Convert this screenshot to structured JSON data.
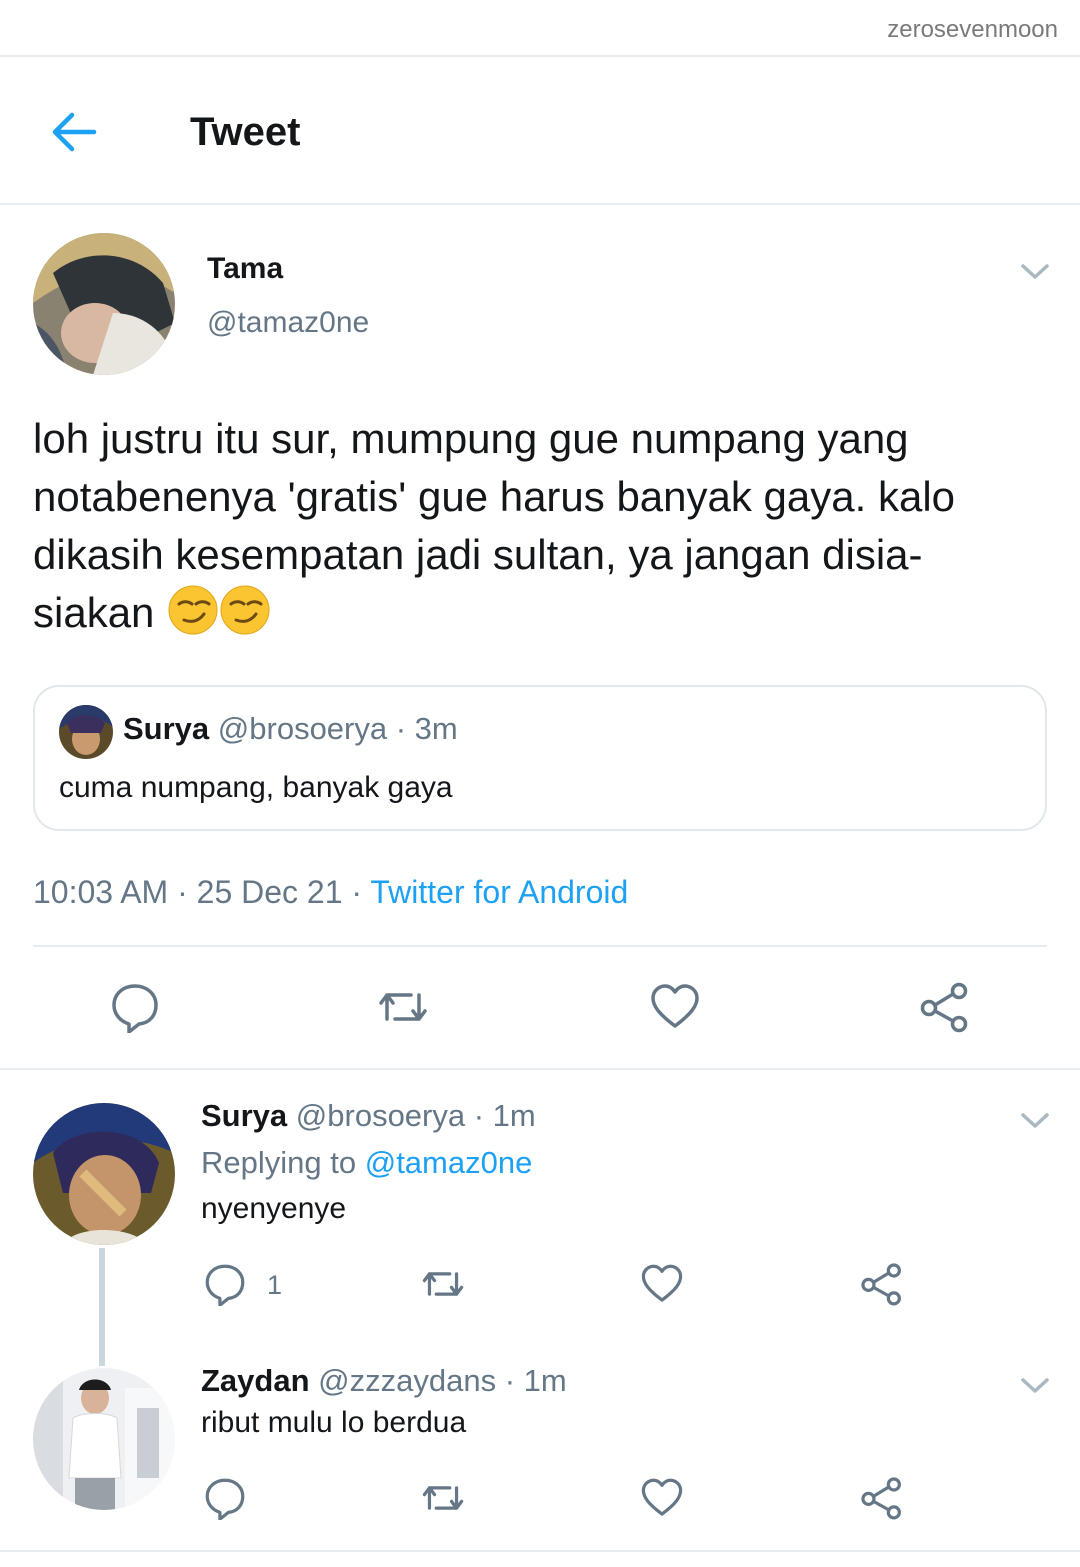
{
  "watermark": "zerosevenmoon",
  "header": {
    "title": "Tweet"
  },
  "main_tweet": {
    "name": "Tama",
    "handle": "@tamaz0ne",
    "text": "loh justru itu sur, mumpung gue numpang yang notabenenya 'gratis' gue harus banyak gaya. kalo dikasih kesempatan jadi sultan, ya jangan disia-siakan",
    "quoted": {
      "name": "Surya",
      "handle": "@brosoerya",
      "time": "· 3m",
      "text": "cuma numpang, banyak gaya"
    },
    "timestamp": "10:03 AM · 25 Dec 21 · ",
    "source": "Twitter for Android"
  },
  "replies": [
    {
      "name": "Surya",
      "handle": "@brosoerya",
      "time": "· 1m",
      "replying_label": "Replying to ",
      "replying_handle": "@tamaz0ne",
      "text": "nyenyenye",
      "reply_count": "1"
    },
    {
      "name": "Zaydan",
      "handle": "@zzzaydans",
      "time": "· 1m",
      "text": "ribut mulu lo berdua"
    }
  ],
  "colors": {
    "accent": "#1da1f2",
    "secondary_text": "#657786",
    "icon_gray": "#657786",
    "divider": "#e6ecf0"
  }
}
